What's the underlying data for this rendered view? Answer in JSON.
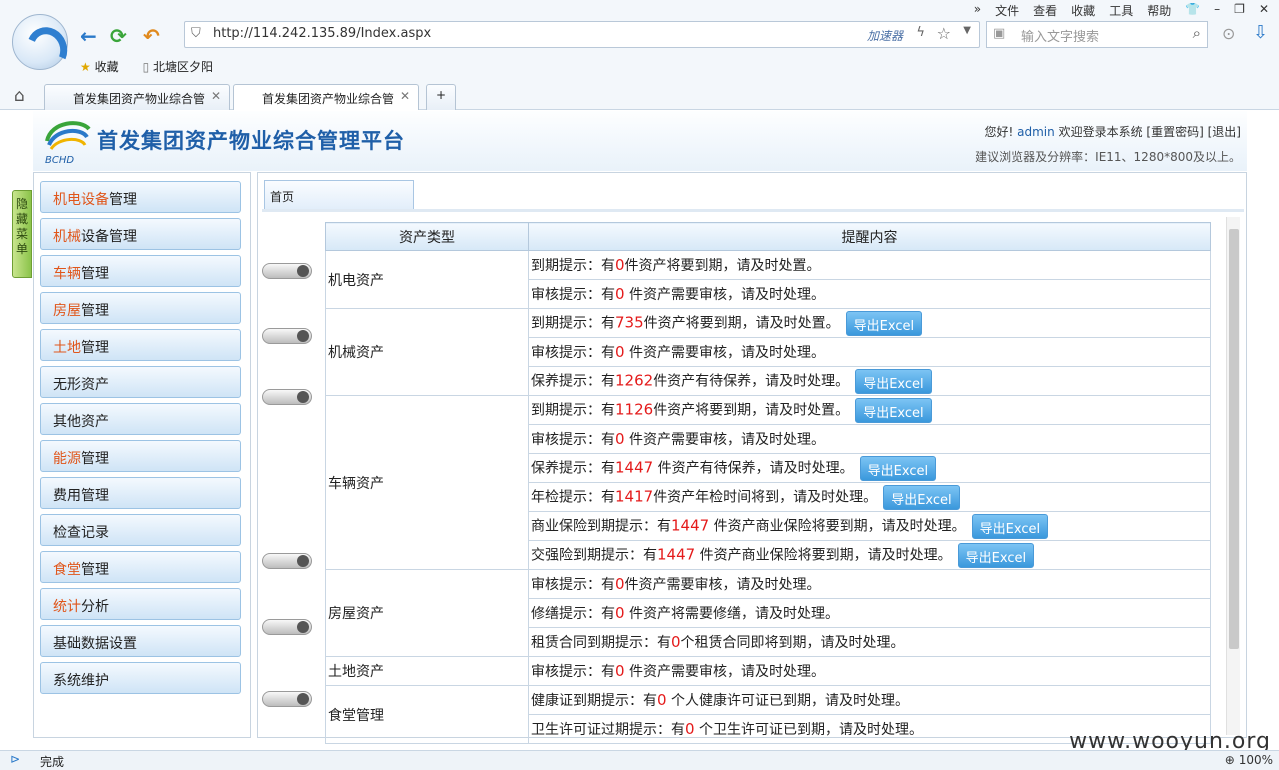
{
  "browser": {
    "menu": [
      "文件",
      "查看",
      "收藏",
      "工具",
      "帮助"
    ],
    "url": "http://114.242.135.89/Index.aspx",
    "accelerator": "加速器",
    "search_placeholder": "输入文字搜索",
    "bookmarks": [
      "收藏",
      "北塘区夕阳"
    ],
    "tabs": [
      "首发集团资产物业综合管",
      "首发集团资产物业综合管"
    ],
    "status": "完成",
    "zoom": "100%",
    "watermark": "www.wooyun.org"
  },
  "site": {
    "logo_text": "BCHD",
    "title": "首发集团资产物业综合管理平台",
    "greeting": "您好!",
    "user": "admin",
    "welcome": "欢迎登录本系统",
    "reset": "[重置密码]",
    "logout": "[退出]",
    "notice": "建议浏览器及分辨率：IE11、1280*800及以上。",
    "hide_menu": "隐藏菜单"
  },
  "sidebar": [
    {
      "hl": "机电设备",
      "rest": "管理"
    },
    {
      "hl": "机械",
      "rest": "设备管理"
    },
    {
      "hl": "车辆",
      "rest": "管理"
    },
    {
      "hl": "房屋",
      "rest": "管理"
    },
    {
      "hl": "土地",
      "rest": "管理"
    },
    {
      "hl": "",
      "rest": "无形资产"
    },
    {
      "hl": "",
      "rest": "其他资产"
    },
    {
      "hl": "能源",
      "rest": "管理"
    },
    {
      "hl": "",
      "rest": "费用管理"
    },
    {
      "hl": "",
      "rest": "检查记录"
    },
    {
      "hl": "食堂",
      "rest": "管理"
    },
    {
      "hl": "统计",
      "rest": "分析"
    },
    {
      "hl": "",
      "rest": "基础数据设置"
    },
    {
      "hl": "",
      "rest": "系统维护"
    }
  ],
  "main": {
    "tab": "首页",
    "headers": [
      "资产类型",
      "提醒内容"
    ],
    "export_label": "导出Excel",
    "groups": [
      {
        "type": "机电资产",
        "rows": [
          {
            "pre": "到期提示：有",
            "num": "0",
            "post": "件资产将要到期，请及时处置。",
            "excel": false
          },
          {
            "pre": "审核提示：有",
            "num": "0",
            "post": " 件资产需要审核，请及时处理。",
            "excel": false
          }
        ]
      },
      {
        "type": "机械资产",
        "rows": [
          {
            "pre": "到期提示：有",
            "num": "735",
            "post": "件资产将要到期，请及时处置。",
            "excel": true
          },
          {
            "pre": "审核提示：有",
            "num": "0",
            "post": " 件资产需要审核，请及时处理。",
            "excel": false
          },
          {
            "pre": "保养提示：有",
            "num": "1262",
            "post": "件资产有待保养，请及时处理。",
            "excel": true
          }
        ]
      },
      {
        "type": "车辆资产",
        "rows": [
          {
            "pre": "到期提示：有",
            "num": "1126",
            "post": "件资产将要到期，请及时处置。",
            "excel": true
          },
          {
            "pre": "审核提示：有",
            "num": "0",
            "post": " 件资产需要审核，请及时处理。",
            "excel": false
          },
          {
            "pre": "保养提示：有",
            "num": "1447",
            "post": " 件资产有待保养，请及时处理。",
            "excel": true
          },
          {
            "pre": "年检提示：有",
            "num": "1417",
            "post": "件资产年检时间将到，请及时处理。",
            "excel": true
          },
          {
            "pre": "商业保险到期提示：有",
            "num": "1447",
            "post": " 件资产商业保险将要到期，请及时处理。",
            "excel": true
          },
          {
            "pre": "交强险到期提示：有",
            "num": "1447",
            "post": " 件资产商业保险将要到期，请及时处理。",
            "excel": true
          }
        ]
      },
      {
        "type": "房屋资产",
        "rows": [
          {
            "pre": "审核提示：有",
            "num": "0",
            "post": "件资产需要审核，请及时处理。",
            "excel": false
          },
          {
            "pre": "修缮提示：有",
            "num": "0",
            "post": " 件资产将需要修缮，请及时处理。",
            "excel": false
          },
          {
            "pre": "租赁合同到期提示：有",
            "num": "0",
            "post": "个租赁合同即将到期，请及时处理。",
            "excel": false
          }
        ]
      },
      {
        "type": "土地资产",
        "rows": [
          {
            "pre": "审核提示：有",
            "num": "0",
            "post": " 件资产需要审核，请及时处理。",
            "excel": false
          }
        ]
      },
      {
        "type": "食堂管理",
        "rows": [
          {
            "pre": "健康证到期提示：有",
            "num": "0",
            "post": " 个人健康许可证已到期，请及时处理。",
            "excel": false
          },
          {
            "pre": "卫生许可证过期提示：有",
            "num": "0",
            "post": " 个卫生许可证已到期，请及时处理。",
            "excel": false
          }
        ]
      }
    ]
  }
}
